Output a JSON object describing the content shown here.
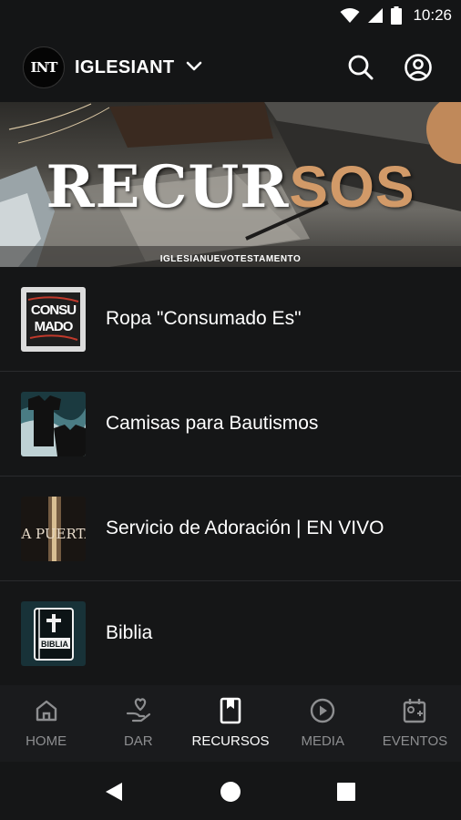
{
  "status_bar": {
    "time": "10:26"
  },
  "header": {
    "logo_text": "INT",
    "church_name": "IGLESIANT"
  },
  "banner": {
    "title_part1": "RECUR",
    "title_part2": "SOS",
    "subtitle": "IGLESIANUEVOTESTAMENTO",
    "accent_color": "#d29a68"
  },
  "resources": [
    {
      "label": "Ropa \"Consumado Es\"",
      "thumb_text": "CONSU MADO"
    },
    {
      "label": "Camisas para Bautismos"
    },
    {
      "label": "Servicio de Adoración | EN VIVO",
      "thumb_text": "LA PUERTA"
    },
    {
      "label": "Biblia",
      "thumb_text": "BIBLIA"
    }
  ],
  "bottom_nav": [
    {
      "label": "HOME",
      "icon": "home-icon"
    },
    {
      "label": "DAR",
      "icon": "give-icon"
    },
    {
      "label": "RECURSOS",
      "icon": "bookmark-book-icon",
      "active": true
    },
    {
      "label": "MEDIA",
      "icon": "play-circle-icon"
    },
    {
      "label": "EVENTOS",
      "icon": "calendar-icon"
    }
  ]
}
